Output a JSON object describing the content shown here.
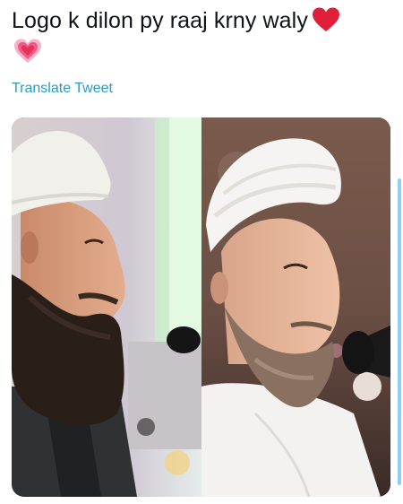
{
  "tweet": {
    "text": "Logo k dilon py raaj krny waly",
    "emoji": [
      "red-heart",
      "sparkling-heart"
    ],
    "translate_label": "Translate Tweet"
  },
  "media": {
    "images": [
      {
        "name": "left-photo",
        "description": "elderly man with white cap and long dark beard in profile"
      },
      {
        "name": "right-photo",
        "description": "man with white turban and grey beard speaking at microphone"
      }
    ]
  },
  "colors": {
    "text": "#0f1419",
    "link": "#2b9bc4",
    "heart_red": "#e0203a",
    "heart_pink": "#f05a83",
    "scrollbar": "#8ed0f5"
  }
}
